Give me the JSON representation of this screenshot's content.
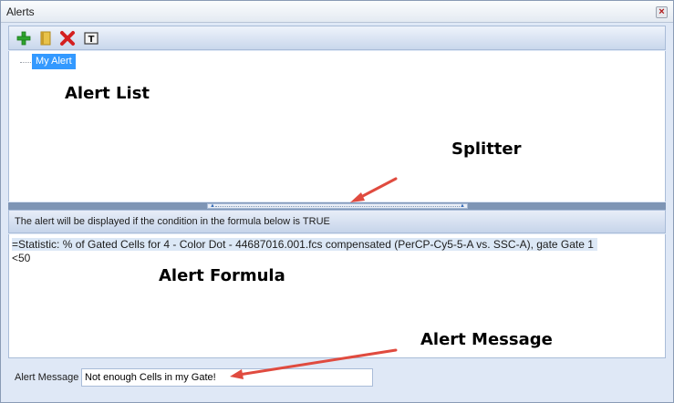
{
  "window": {
    "title": "Alerts",
    "close_glyph": "×"
  },
  "toolbar": {
    "icons": [
      "add-icon",
      "folder-icon",
      "delete-icon",
      "rename-icon"
    ]
  },
  "alert_list": {
    "items": [
      {
        "label": "My Alert",
        "selected": true
      }
    ]
  },
  "formula": {
    "header": "The alert will be displayed if the condition in the formula below is TRUE",
    "line1": "=Statistic: % of Gated Cells for 4 - Color Dot - 44687016.001.fcs compensated (PerCP-Cy5-5-A vs. SSC-A), gate Gate 1",
    "line2": "<50"
  },
  "message": {
    "label": "Alert Message",
    "value": "Not enough Cells in my Gate!"
  },
  "annotations": {
    "alert_list": "Alert List",
    "splitter": "Splitter",
    "alert_formula": "Alert Formula",
    "alert_message": "Alert Message"
  },
  "colors": {
    "selection": "#3399ff",
    "arrow": "#e04b3f",
    "panel": "#dfe8f6"
  }
}
